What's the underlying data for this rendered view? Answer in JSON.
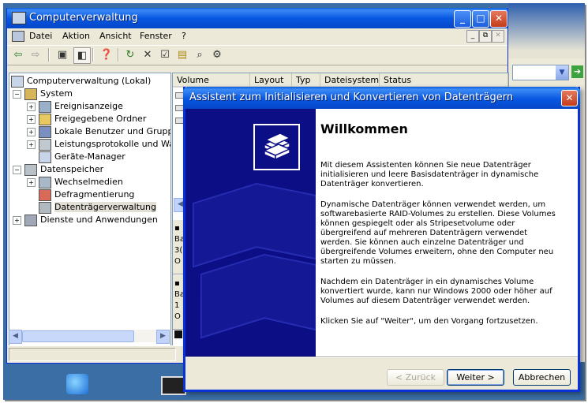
{
  "main_window": {
    "title": "Computerverwaltung",
    "menu": [
      "Datei",
      "Aktion",
      "Ansicht",
      "Fenster",
      "?"
    ],
    "tree": [
      {
        "label": "Computerverwaltung (Lokal)"
      },
      {
        "label": "System"
      },
      {
        "label": "Ereignisanzeige"
      },
      {
        "label": "Freigegebene Ordner"
      },
      {
        "label": "Lokale Benutzer und Gruppen"
      },
      {
        "label": "Leistungsprotokolle und Warnungen"
      },
      {
        "label": "Geräte-Manager"
      },
      {
        "label": "Datenspeicher"
      },
      {
        "label": "Wechselmedien"
      },
      {
        "label": "Defragmentierung"
      },
      {
        "label": "Datenträgerverwaltung"
      },
      {
        "label": "Dienste und Anwendungen"
      }
    ],
    "columns": [
      "Volume",
      "Layout",
      "Typ",
      "Dateisystem",
      "Status"
    ],
    "disk_rows": [
      {
        "l1": "Ba",
        "l2": "3(",
        "l3": "O"
      },
      {
        "l1": "Ba",
        "l2": "1",
        "l3": "O"
      }
    ]
  },
  "wizard": {
    "title": "Assistent zum Initialisieren und Konvertieren von Datenträgern",
    "heading": "Willkommen",
    "paragraphs": [
      "Mit diesem Assistenten können Sie neue Datenträger initialisieren und leere Basisdatenträger in dynamische Datenträger konvertieren.",
      "Dynamische Datenträger können verwendet werden, um softwarebasierte RAID-Volumes zu erstellen. Diese Volumes können gespiegelt oder als Stripesetvolume oder übergreifend auf mehreren Datenträgern verwendet werden. Sie können auch einzelne Datenträger und übergreifende Volumes erweitern, ohne den Computer neu starten zu müssen.",
      "Nachdem ein Datenträger in ein dynamisches Volume konvertiert wurde, kann nur Windows 2000 oder höher auf Volumes auf diesem Datenträger verwendet werden.",
      "Klicken Sie auf \"Weiter\", um den Vorgang fortzusetzen."
    ],
    "buttons": {
      "back": "< Zurück",
      "next": "Weiter >",
      "cancel": "Abbrechen"
    }
  }
}
